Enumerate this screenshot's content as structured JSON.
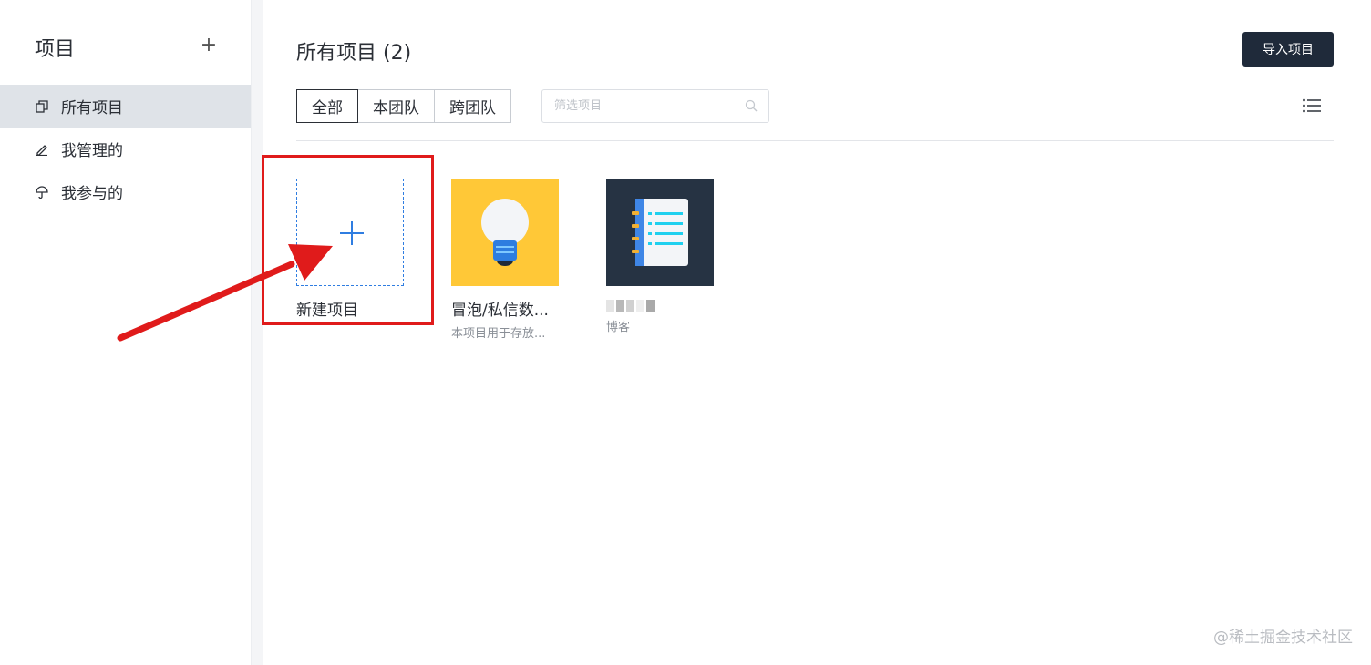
{
  "sidebar": {
    "title": "项目",
    "add_symbol": "+",
    "items": [
      {
        "label": "所有项目",
        "icon": "copy-icon",
        "active": true
      },
      {
        "label": "我管理的",
        "icon": "edit-icon",
        "active": false
      },
      {
        "label": "我参与的",
        "icon": "umbrella-icon",
        "active": false
      }
    ]
  },
  "header": {
    "title": "所有项目 (2)",
    "import_label": "导入项目"
  },
  "filters": {
    "tabs": [
      "全部",
      "本团队",
      "跨团队"
    ],
    "active_tab": "全部",
    "search_placeholder": "筛选项目"
  },
  "projects": {
    "new_label": "新建项目",
    "items": [
      {
        "title": "冒泡/私信数...",
        "desc": "本项目用于存放...",
        "icon": "lightbulb-icon",
        "color": "#ffc837"
      },
      {
        "title": "",
        "desc": "博客",
        "icon": "notebook-icon",
        "color": "#263343"
      }
    ]
  },
  "watermark": "@稀土掘金技术社区",
  "colors": {
    "accent": "#2f7de1",
    "primary_button": "#1f2a3a",
    "highlight": "#e01b1b",
    "active_nav": "#dfe3e8"
  }
}
